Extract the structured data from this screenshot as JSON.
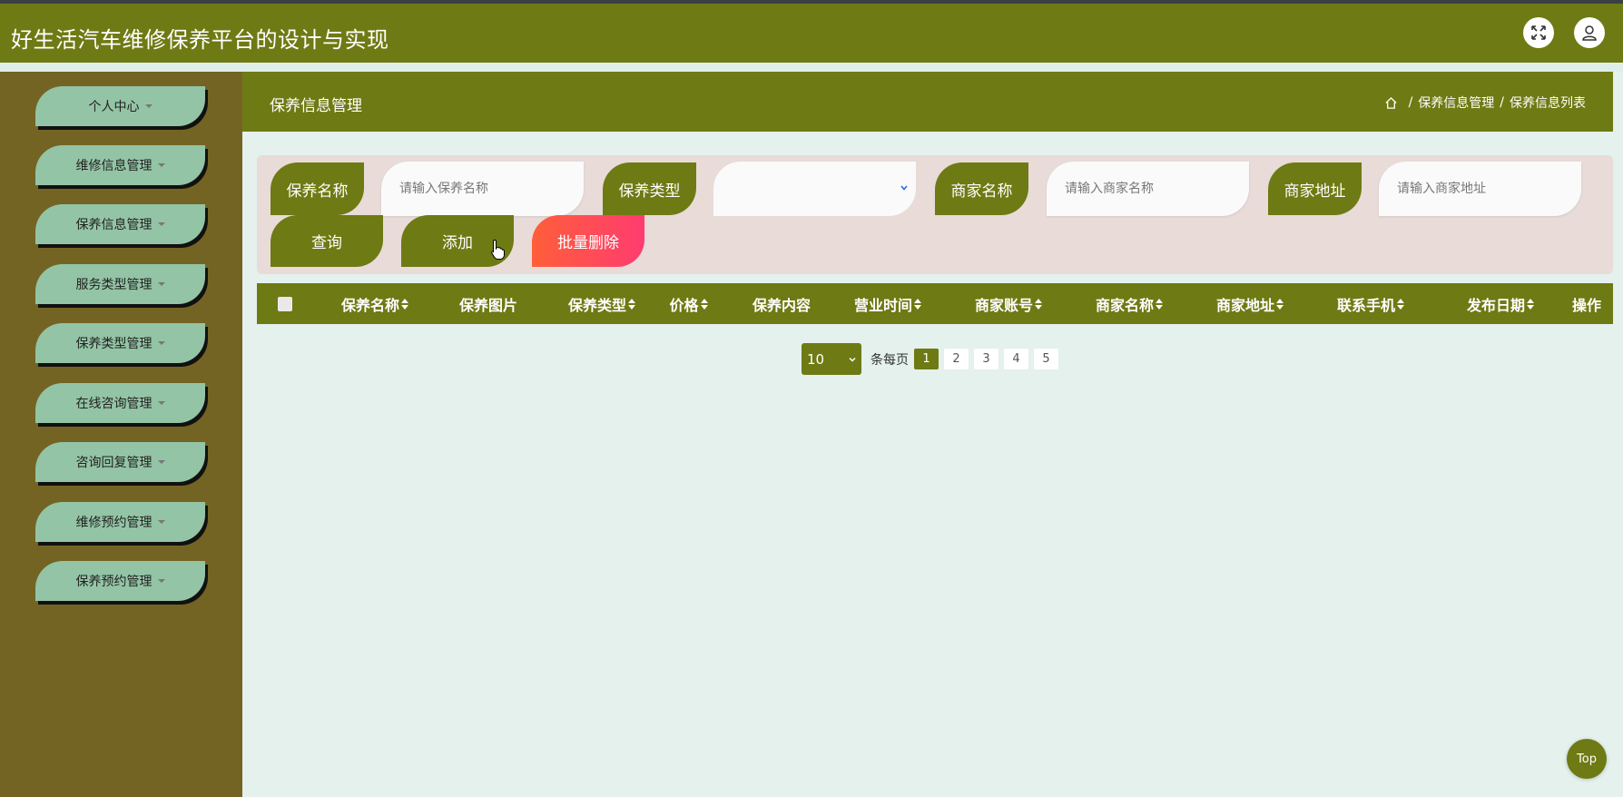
{
  "app": {
    "title": "好生活汽车维修保养平台的设计与实现"
  },
  "topbar": {
    "fullscreen_icon": "expand-icon",
    "user_icon": "user-icon"
  },
  "sidebar": {
    "items": [
      {
        "label": "个人中心"
      },
      {
        "label": "维修信息管理"
      },
      {
        "label": "保养信息管理"
      },
      {
        "label": "服务类型管理"
      },
      {
        "label": "保养类型管理"
      },
      {
        "label": "在线咨询管理"
      },
      {
        "label": "咨询回复管理"
      },
      {
        "label": "维修预约管理"
      },
      {
        "label": "保养预约管理"
      }
    ]
  },
  "header": {
    "title": "保养信息管理",
    "breadcrumb": [
      "保养信息管理",
      "保养信息列表"
    ],
    "separator": "/"
  },
  "search": {
    "fields": [
      {
        "label": "保养名称",
        "placeholder": "请输入保养名称",
        "type": "input"
      },
      {
        "label": "保养类型",
        "placeholder": "",
        "type": "select"
      },
      {
        "label": "商家名称",
        "placeholder": "请输入商家名称",
        "type": "input"
      },
      {
        "label": "商家地址",
        "placeholder": "请输入商家地址",
        "type": "input"
      }
    ],
    "buttons": {
      "query": "查询",
      "add": "添加",
      "batch_delete": "批量删除"
    }
  },
  "table": {
    "columns": [
      {
        "label": "保养名称",
        "sortable": true
      },
      {
        "label": "保养图片",
        "sortable": false
      },
      {
        "label": "保养类型",
        "sortable": true
      },
      {
        "label": "价格",
        "sortable": true
      },
      {
        "label": "保养内容",
        "sortable": false
      },
      {
        "label": "营业时间",
        "sortable": true
      },
      {
        "label": "商家账号",
        "sortable": true
      },
      {
        "label": "商家名称",
        "sortable": true
      },
      {
        "label": "商家地址",
        "sortable": true
      },
      {
        "label": "联系手机",
        "sortable": true
      },
      {
        "label": "发布日期",
        "sortable": true
      },
      {
        "label": "操作",
        "sortable": false
      }
    ],
    "rows": []
  },
  "pagination": {
    "page_size": "10",
    "per_page_label": "条每页",
    "pages": [
      "1",
      "2",
      "3",
      "4",
      "5"
    ],
    "current": "1"
  },
  "back_to_top": "Top",
  "colors": {
    "primary": "#6e7a13",
    "sidebar": "#736424",
    "menu_item": "#93c4a5",
    "danger": "#ff4d5a"
  }
}
